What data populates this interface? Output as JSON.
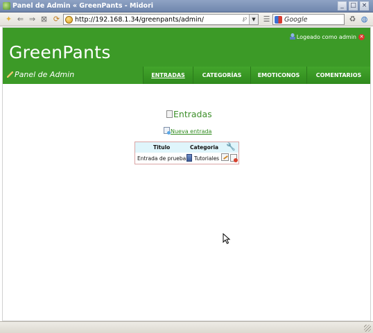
{
  "window": {
    "title": "Panel de Admin « GreenPants - Midori",
    "controls": [
      "minimize",
      "maximize",
      "close"
    ]
  },
  "toolbar": {
    "url": "http://192.168.1.34/greenpants/admin/",
    "search_placeholder": "Google",
    "icons": [
      "new-tab-icon",
      "back-icon",
      "forward-icon",
      "stop-icon",
      "reload-icon",
      "home-icon",
      "rss-icon",
      "menu-icon",
      "search-engine-icon",
      "trash-icon",
      "web-icon"
    ]
  },
  "site": {
    "brand": "GreenPants",
    "login_text": "Logeado como admin",
    "panel_label": "Panel de Admin",
    "nav": [
      {
        "label": "ENTRADAS",
        "active": true
      },
      {
        "label": "CATEGORÍAS",
        "active": false
      },
      {
        "label": "EMOTICONOS",
        "active": false
      },
      {
        "label": "COMENTARIOS",
        "active": false
      }
    ],
    "colors": {
      "header_green": "#3c9a27",
      "link_green": "#2f8a1d",
      "table_header": "#dff5fb"
    }
  },
  "main": {
    "title": "Entradas",
    "new_entry_link": "Nueva entrada",
    "table": {
      "headers": [
        "Titulo",
        "Categoria"
      ],
      "rows": [
        {
          "titulo": "Entrada de prueba",
          "categoria": "Tutoriales"
        }
      ]
    }
  }
}
